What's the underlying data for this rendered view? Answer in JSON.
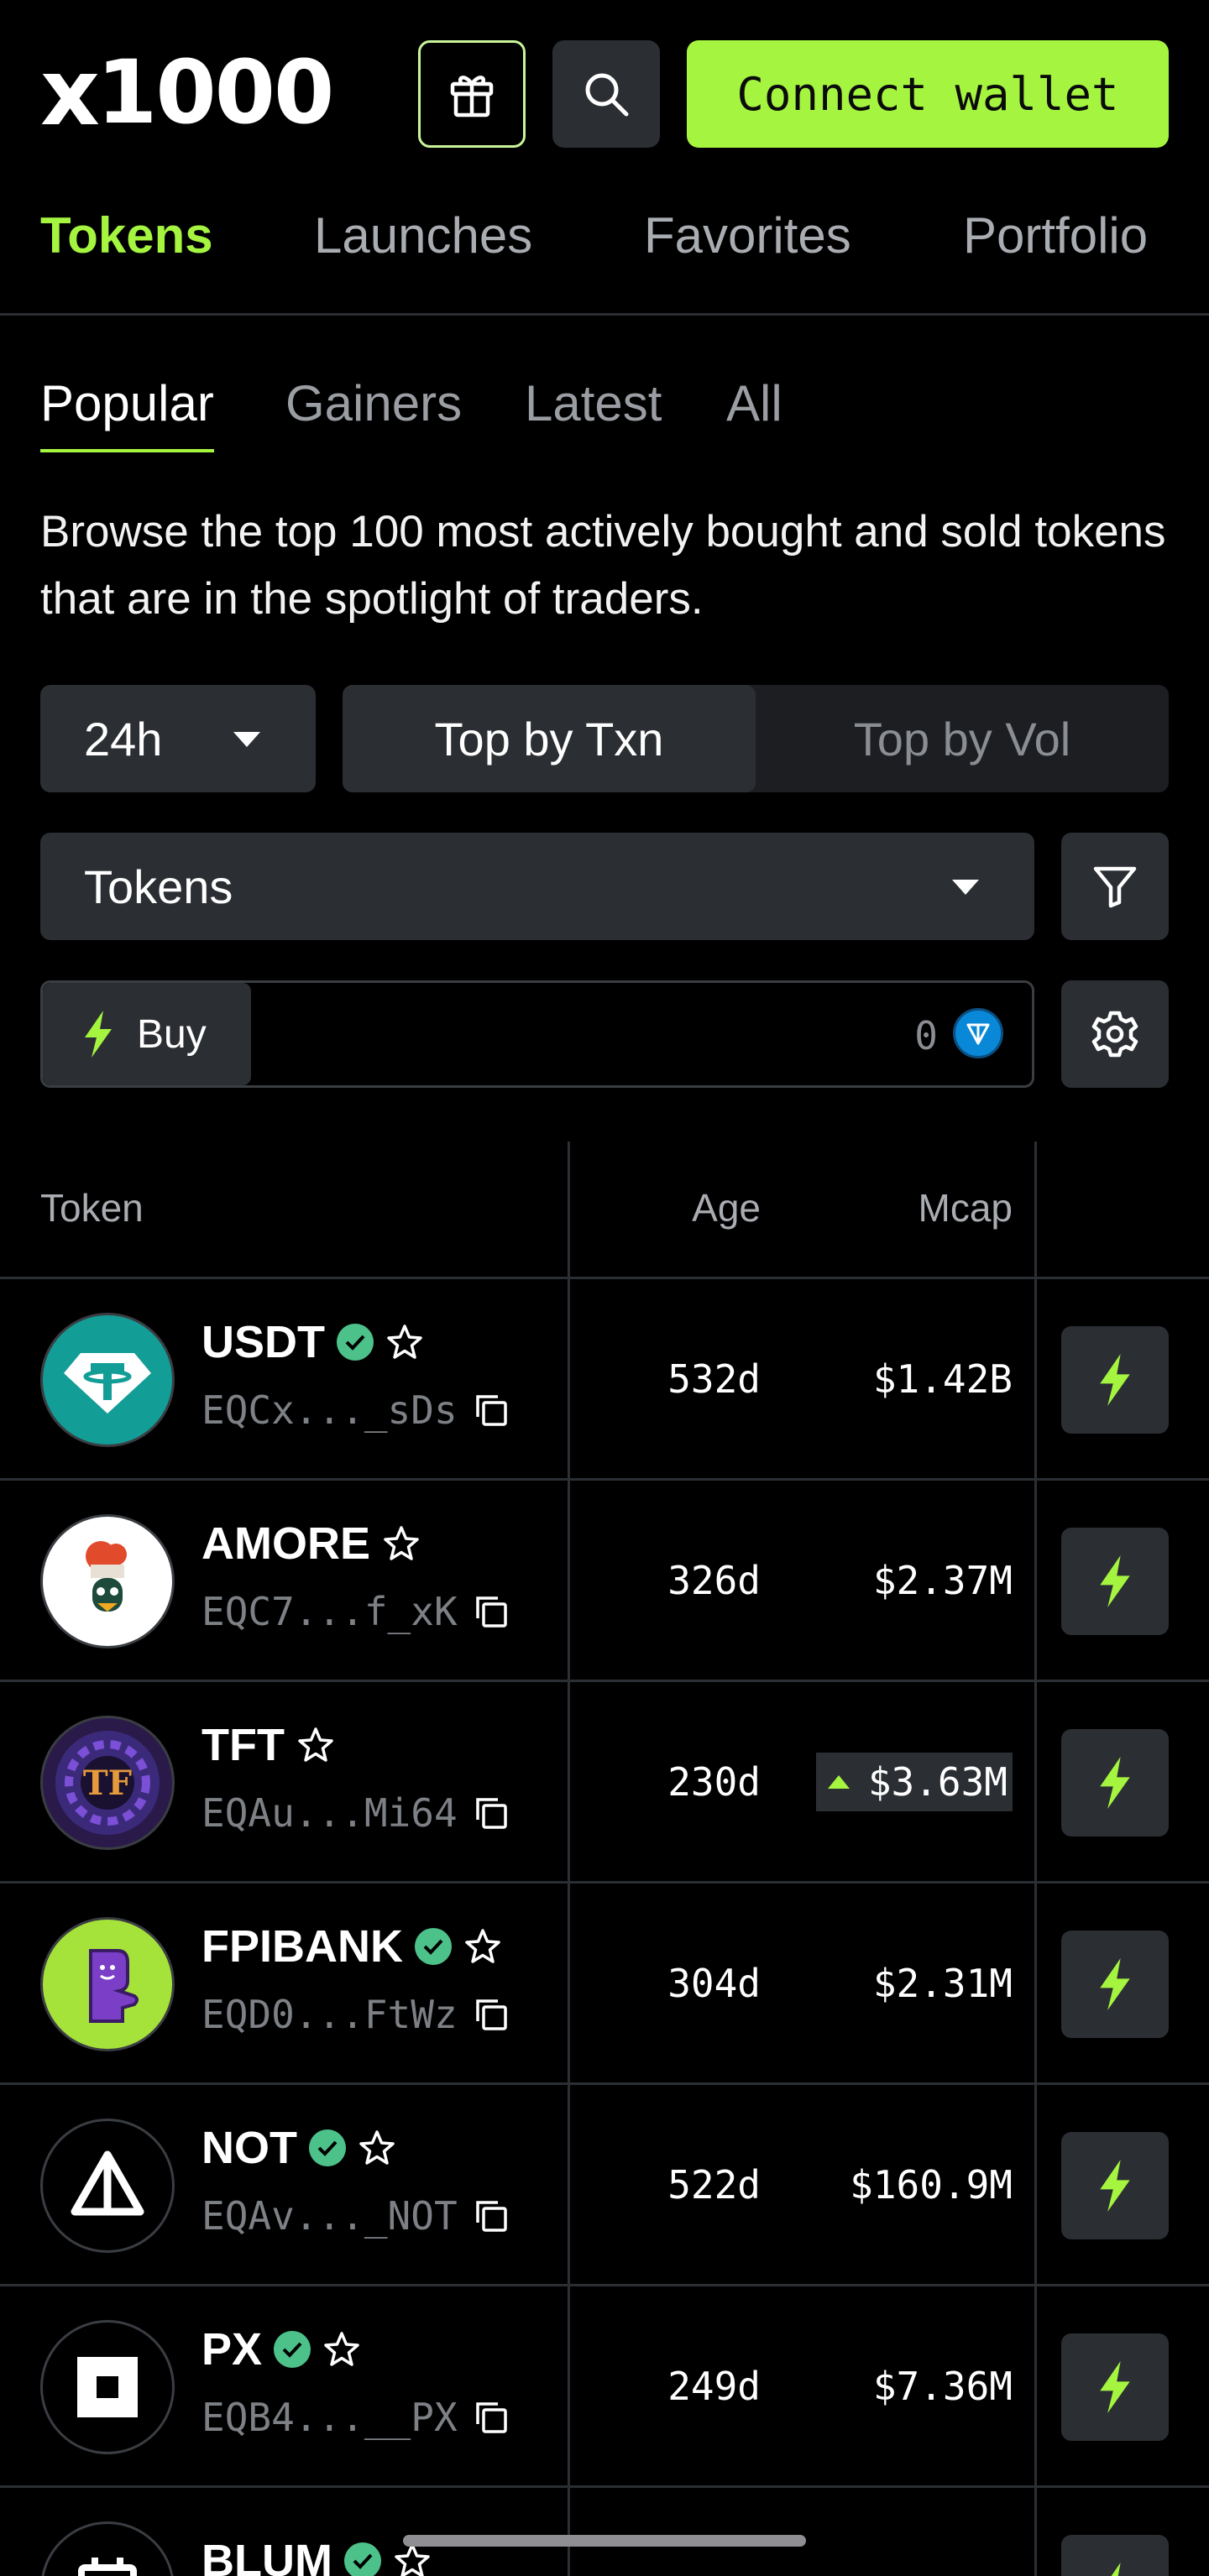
{
  "header": {
    "logo_x": "x",
    "logo_num": "1000",
    "connect_label": "Connect wallet"
  },
  "main_tabs": [
    {
      "label": "Tokens",
      "active": true
    },
    {
      "label": "Launches"
    },
    {
      "label": "Favorites"
    },
    {
      "label": "Portfolio"
    }
  ],
  "sub_tabs": [
    {
      "label": "Popular",
      "active": true
    },
    {
      "label": "Gainers"
    },
    {
      "label": "Latest"
    },
    {
      "label": "All"
    }
  ],
  "description": "Browse the top 100 most actively bought and sold tokens that are in the spotlight of traders.",
  "controls": {
    "time_value": "24h",
    "segment": [
      "Top by Txn",
      "Top by Vol"
    ],
    "segment_active": "Top by Txn",
    "type_value": "Tokens",
    "buy_label": "Buy",
    "buy_amount": "0"
  },
  "table": {
    "headers": {
      "token": "Token",
      "age": "Age",
      "mcap": "Mcap"
    },
    "rows": [
      {
        "name": "USDT",
        "verified": true,
        "address": "EQCx..._sDs",
        "age": "532d",
        "mcap": "$1.42B"
      },
      {
        "name": "AMORE",
        "verified": false,
        "address": "EQC7...f_xK",
        "age": "326d",
        "mcap": "$2.37M"
      },
      {
        "name": "TFT",
        "verified": false,
        "address": "EQAu...Mi64",
        "age": "230d",
        "mcap": "$3.63M",
        "up": true
      },
      {
        "name": "FPIBANK",
        "verified": true,
        "address": "EQD0...FtWz",
        "age": "304d",
        "mcap": "$2.31M"
      },
      {
        "name": "NOT",
        "verified": true,
        "address": "EQAv..._NOT",
        "age": "522d",
        "mcap": "$160.9M"
      },
      {
        "name": "PX",
        "verified": true,
        "address": "EQB4...__PX",
        "age": "249d",
        "mcap": "$7.36M"
      },
      {
        "name": "BLUM",
        "verified": true,
        "address": "",
        "age": "",
        "mcap": ""
      }
    ]
  },
  "colors": {
    "accent": "#a5f540",
    "background": "#000000",
    "surface": "#2b2e33",
    "verified": "#4cc28a"
  }
}
